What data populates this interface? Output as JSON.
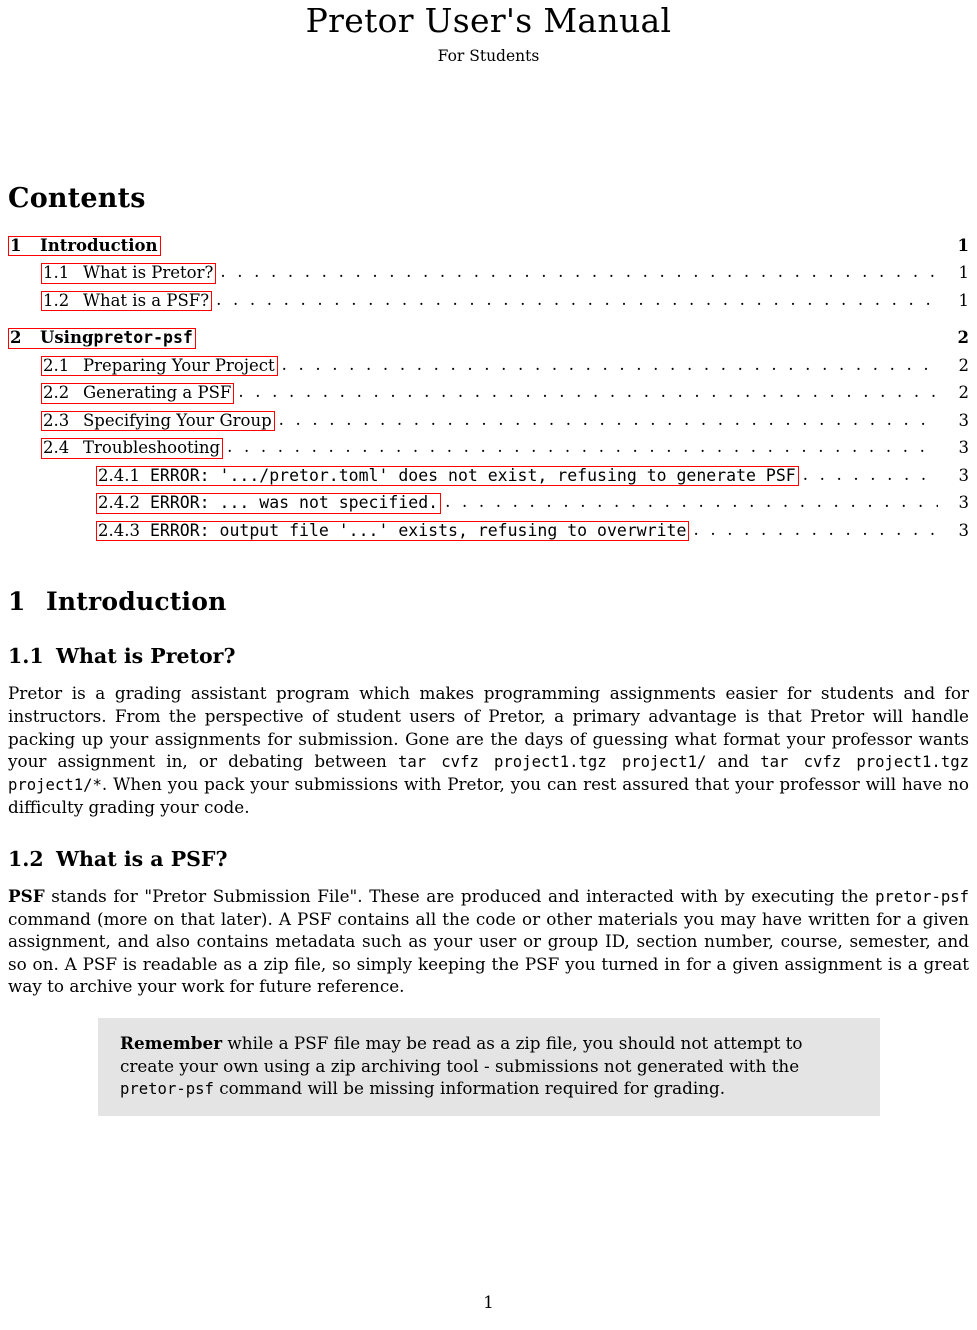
{
  "document": {
    "title": "Pretor User's Manual",
    "subtitle": "For Students",
    "page_number": "1"
  },
  "contents": {
    "heading": "Contents",
    "dots": ". . . . . . . . . . . . . . . . . . . . . . . . . . . . . . . . . . . . . . . . . . . . . . . . . . . . . . . . . . . . . . . . . . . . . . . . . . . . . . . . . . . . . . . . . . . .",
    "entries": [
      {
        "level": 1,
        "number": "1",
        "title": "Introduction",
        "title_mono": "",
        "page": "1"
      },
      {
        "level": 2,
        "number": "1.1",
        "title": "What is Pretor?",
        "title_mono": "",
        "page": "1"
      },
      {
        "level": 2,
        "number": "1.2",
        "title": "What is a PSF?",
        "title_mono": "",
        "page": "1"
      },
      {
        "level": 1,
        "number": "2",
        "title": "Using ",
        "title_mono": "pretor-psf",
        "page": "2"
      },
      {
        "level": 2,
        "number": "2.1",
        "title": "Preparing Your Project",
        "title_mono": "",
        "page": "2"
      },
      {
        "level": 2,
        "number": "2.2",
        "title": "Generating a PSF",
        "title_mono": "",
        "page": "2"
      },
      {
        "level": 2,
        "number": "2.3",
        "title": "Specifying Your Group",
        "title_mono": "",
        "page": "3"
      },
      {
        "level": 2,
        "number": "2.4",
        "title": "Troubleshooting",
        "title_mono": "",
        "page": "3"
      },
      {
        "level": 3,
        "number": "2.4.1",
        "title": "",
        "title_mono": "ERROR: '.../pretor.toml' does not exist, refusing to generate PSF",
        "page": "3"
      },
      {
        "level": 3,
        "number": "2.4.2",
        "title": "",
        "title_mono": "ERROR: ... was not specified.",
        "page": "3"
      },
      {
        "level": 3,
        "number": "2.4.3",
        "title": "",
        "title_mono": "ERROR: output file '...' exists, refusing to overwrite",
        "page": "3"
      }
    ]
  },
  "section1": {
    "number": "1",
    "heading": "Introduction",
    "sub1": {
      "number": "1.1",
      "heading": "What is Pretor?",
      "para_a": "Pretor is a grading assistant program which makes programming assignments easier for students and for instructors. From the perspective of student users of Pretor, a primary advantage is that Pretor will handle packing up your assignments for submission. Gone are the days of guessing what format your professor wants your assignment in, or debating between ",
      "code_a": "tar cvfz project1.tgz project1/",
      "para_b": " and ",
      "code_b": "tar cvfz project1.tgz project1/*",
      "para_c": ". When you pack your submissions with Pretor, you can rest assured that your professor will have no difficulty grading your code."
    },
    "sub2": {
      "number": "1.2",
      "heading": "What is a PSF?",
      "lead": "PSF",
      "para_a": " stands for \"Pretor Submission File\".  These are produced and interacted with by executing the ",
      "code_a": "pretor-psf",
      "para_b": " command (more on that later).  A PSF contains all the code or other materials you may have written for a given assignment, and also contains metadata such as your user or group ID, section number, course, semester, and so on. A PSF is readable as a zip file, so simply keeping the PSF you turned in for a given assignment is a great way to archive your work for future reference."
    }
  },
  "callout": {
    "lead": "Remember",
    "text_a": " while a PSF file may be read as a zip file, you should not attempt to create your own using a zip archiving tool - submissions not generated with the ",
    "code": "pretor-psf",
    "text_b": " command will be missing information required for grading."
  },
  "colors": {
    "link_box": "#ff0000",
    "callout_background": "#e4e4e4",
    "text": "#000000"
  }
}
